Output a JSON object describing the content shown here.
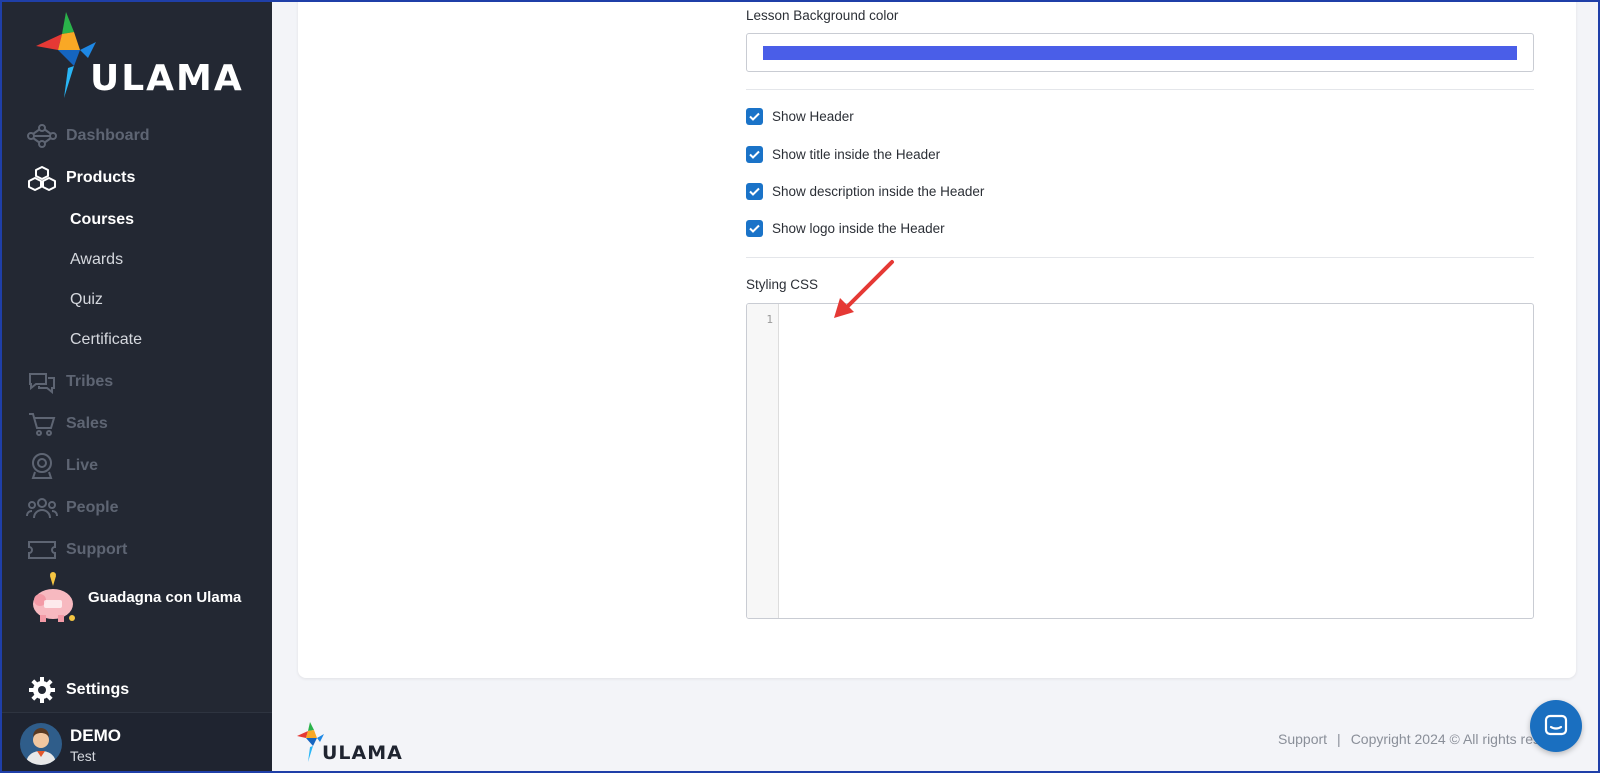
{
  "brand": {
    "name": "ULAMA",
    "accent": "#1a73c8",
    "sidebar_bg": "#232833"
  },
  "sidebar": {
    "nav": [
      {
        "label": "Dashboard",
        "icon": "network-icon",
        "state": "dim"
      },
      {
        "label": "Products",
        "icon": "cubes-icon",
        "state": "active"
      }
    ],
    "sub_items": [
      {
        "label": "Courses",
        "current": true
      },
      {
        "label": "Awards"
      },
      {
        "label": "Quiz"
      },
      {
        "label": "Certificate"
      }
    ],
    "nav_more": [
      {
        "label": "Tribes",
        "icon": "chat-bubbles-icon"
      },
      {
        "label": "Sales",
        "icon": "cart-icon"
      },
      {
        "label": "Live",
        "icon": "webcam-icon"
      },
      {
        "label": "People",
        "icon": "people-icon"
      },
      {
        "label": "Support",
        "icon": "ticket-icon"
      }
    ],
    "promo_label": "Guadagna con Ulama",
    "settings_label": "Settings",
    "user": {
      "name": "DEMO",
      "role": "Test"
    }
  },
  "form": {
    "lesson_bg_label": "Lesson Background color",
    "lesson_bg_color": "#4a5ee8",
    "checkboxes": [
      {
        "label": "Show Header",
        "checked": true
      },
      {
        "label": "Show title inside the Header",
        "checked": true
      },
      {
        "label": "Show description inside the Header",
        "checked": true
      },
      {
        "label": "Show logo inside the Header",
        "checked": true
      }
    ],
    "styling_css_label": "Styling CSS",
    "editor_line_number": "1"
  },
  "footer": {
    "logo_text": "ULAMA",
    "support_link": "Support",
    "separator": "|",
    "copyright": "Copyright 2024 © All rights reserved"
  }
}
